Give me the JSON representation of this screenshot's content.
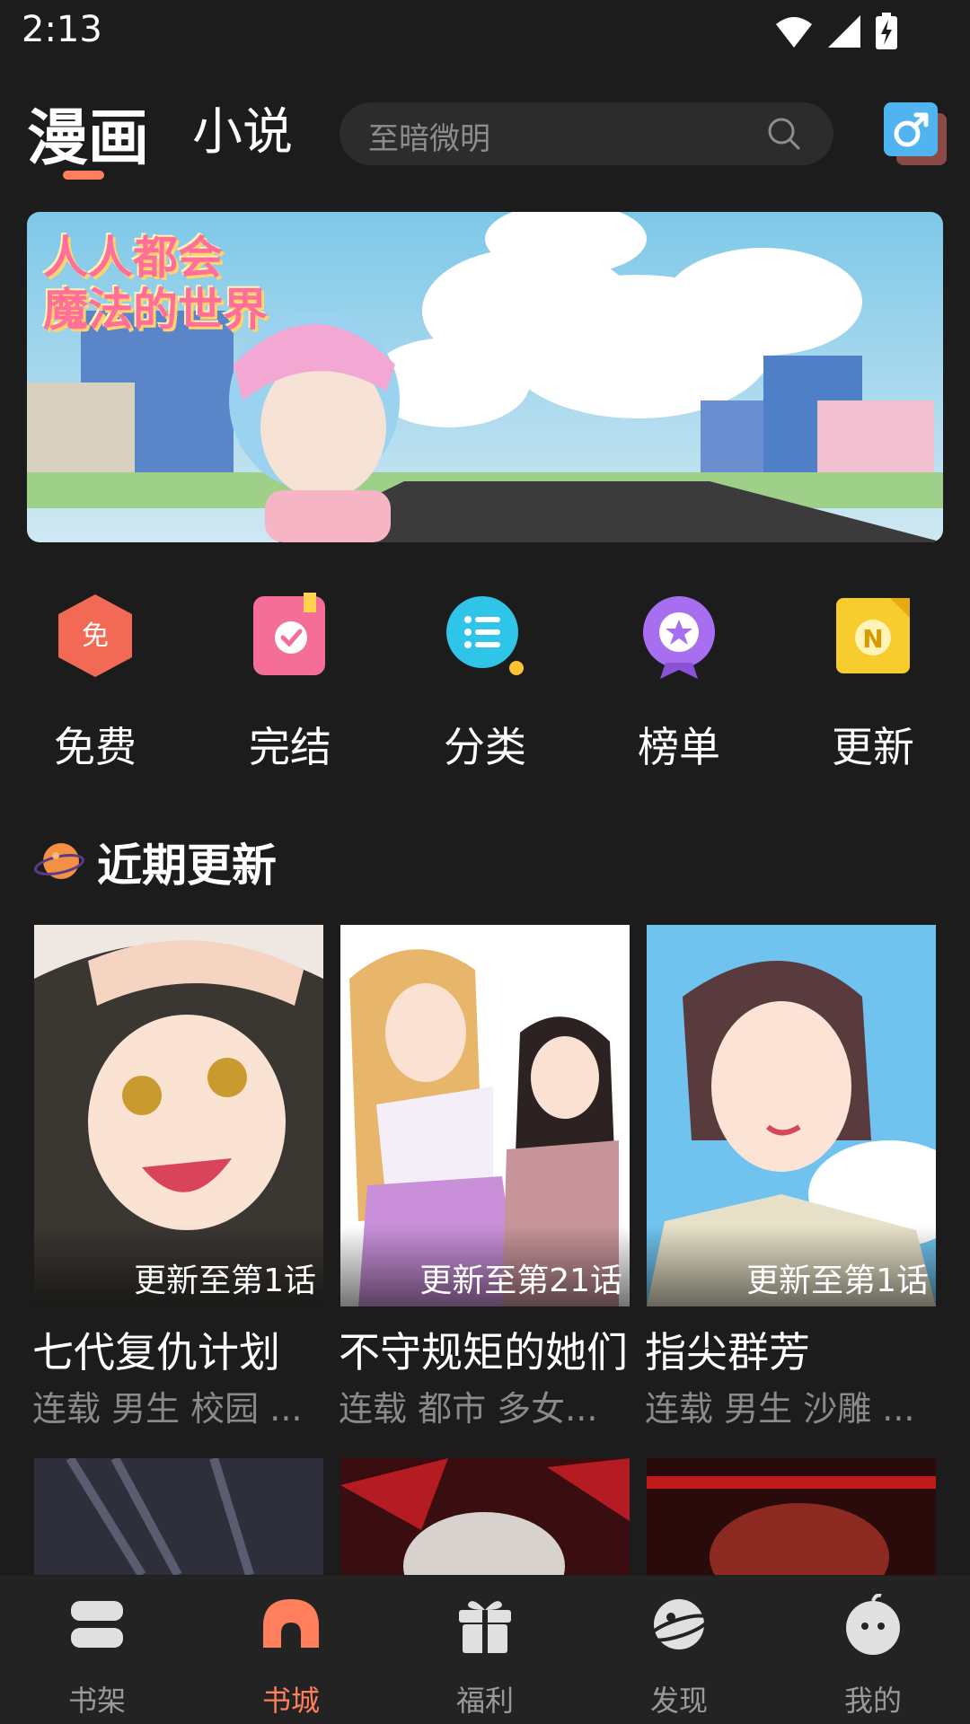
{
  "status_bar": {
    "time": "2:13"
  },
  "header": {
    "tabs": [
      {
        "label": "漫画",
        "active": true
      },
      {
        "label": "小说",
        "active": false
      }
    ],
    "search_placeholder": "至暗微明",
    "accent_color": "#ff7f5c"
  },
  "banner": {
    "title_line1": "人人都会",
    "title_line2": "魔法的世界"
  },
  "quick_menu": [
    {
      "label": "免费",
      "icon": "free-icon"
    },
    {
      "label": "完结",
      "icon": "completed-icon"
    },
    {
      "label": "分类",
      "icon": "category-icon"
    },
    {
      "label": "榜单",
      "icon": "ranking-icon"
    },
    {
      "label": "更新",
      "icon": "update-icon"
    }
  ],
  "section": {
    "title": "近期更新"
  },
  "comics": [
    {
      "title": "七代复仇计划",
      "update": "更新至第1话",
      "tags": "连载 男生 校园 ..."
    },
    {
      "title": "不守规矩的她们",
      "update": "更新至第21话",
      "tags": "连载 都市 多女..."
    },
    {
      "title": "指尖群芳",
      "update": "更新至第1话",
      "tags": "连载 男生 沙雕 ..."
    }
  ],
  "bottom_nav": [
    {
      "label": "书架",
      "icon": "bookshelf-icon",
      "active": false
    },
    {
      "label": "书城",
      "icon": "bookstore-icon",
      "active": true
    },
    {
      "label": "福利",
      "icon": "gift-icon",
      "active": false
    },
    {
      "label": "发现",
      "icon": "discover-icon",
      "active": false
    },
    {
      "label": "我的",
      "icon": "profile-icon",
      "active": false
    }
  ]
}
